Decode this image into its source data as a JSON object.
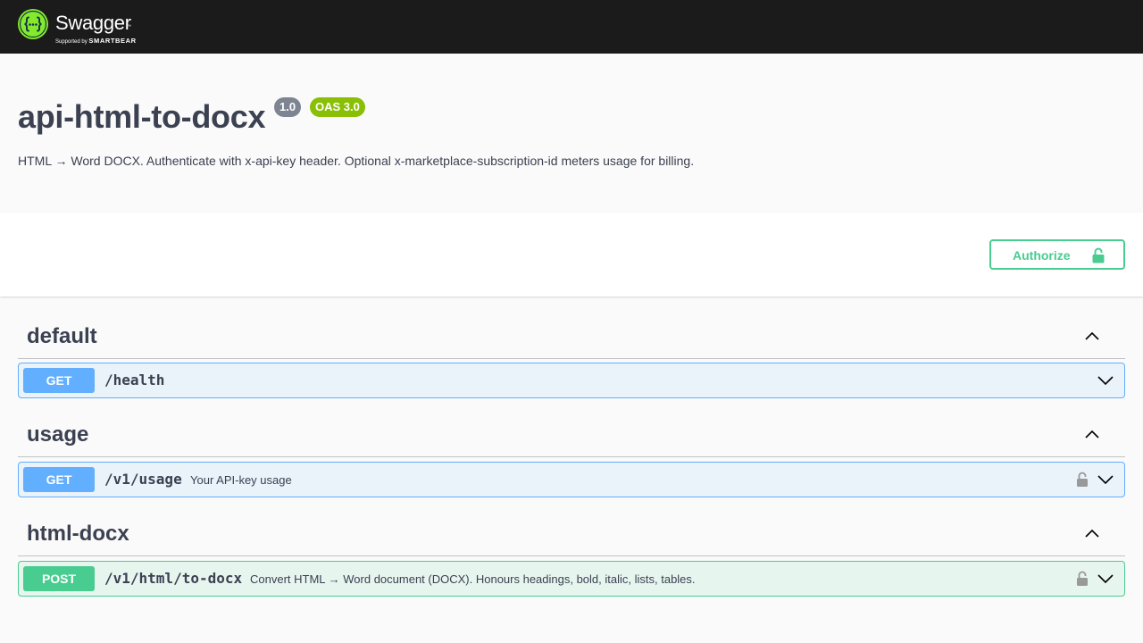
{
  "topbar": {
    "brand_name": "Swagger",
    "brand_tm": "™",
    "brand_sub_prefix": "Supported by",
    "brand_sub_company": "SMARTBEAR",
    "logo_icon": "swagger-logo-icon",
    "logo_color": "#85ea2d"
  },
  "info": {
    "title": "api-html-to-docx",
    "version": "1.0",
    "oas_version": "OAS 3.0",
    "description": "HTML → Word DOCX. Authenticate with x-api-key header. Optional x-marketplace-subscription-id meters usage for billing."
  },
  "scheme": {
    "authorize_label": "Authorize",
    "authorize_icon": "unlock-icon"
  },
  "colors": {
    "get": "#61affe",
    "post": "#49cc90",
    "text": "#3b4151",
    "topbar": "#1b1b1b"
  },
  "tags": [
    {
      "name": "default",
      "operations": [
        {
          "method": "GET",
          "path": "/health",
          "summary": ""
        }
      ]
    },
    {
      "name": "usage",
      "operations": [
        {
          "method": "GET",
          "path": "/v1/usage",
          "summary": "Your API-key usage",
          "locked": true
        }
      ]
    },
    {
      "name": "html-docx",
      "operations": [
        {
          "method": "POST",
          "path": "/v1/html/to-docx",
          "summary": "Convert HTML → Word document (DOCX). Honours headings, bold, italic, lists, tables.",
          "locked": true
        }
      ]
    }
  ]
}
